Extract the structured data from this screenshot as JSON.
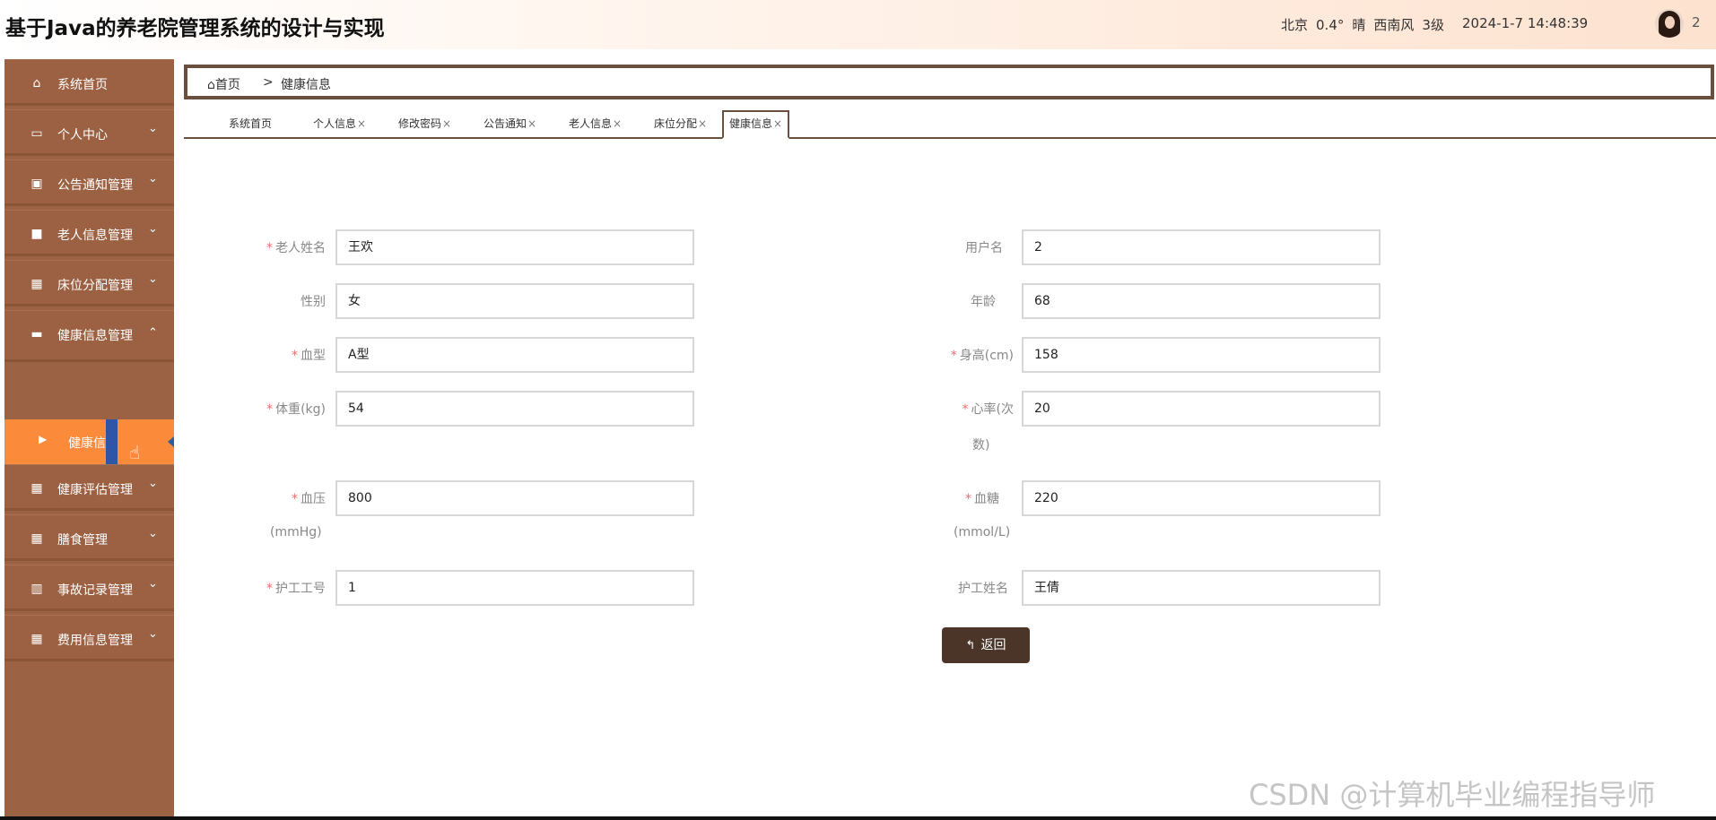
{
  "header": {
    "title": "基于Java的养老院管理系统的设计与实现",
    "weather": {
      "city": "北京",
      "temp": "0.4°",
      "condition": "晴",
      "wind": "西南风",
      "level": "3级"
    },
    "datetime": "2024-1-7 14:48:39",
    "user": "2"
  },
  "sidebar": {
    "items": [
      {
        "label": "系统首页",
        "icon": "home-icon"
      },
      {
        "label": "个人中心",
        "icon": "card-icon"
      },
      {
        "label": "公告通知管理",
        "icon": "clipboard-icon"
      },
      {
        "label": "老人信息管理",
        "icon": "briefcase-icon"
      },
      {
        "label": "床位分配管理",
        "icon": "grid-icon"
      },
      {
        "label": "健康信息管理",
        "icon": "ticket-icon"
      },
      {
        "label": "健康评估管理",
        "icon": "grid-icon"
      },
      {
        "label": "膳食管理",
        "icon": "grid-icon"
      },
      {
        "label": "事故记录管理",
        "icon": "chart-icon"
      },
      {
        "label": "费用信息管理",
        "icon": "grid-icon"
      }
    ],
    "submenu": {
      "label": "健康信息"
    }
  },
  "breadcrumb": {
    "home": "首页",
    "separator": ">",
    "current": "健康信息"
  },
  "tabs": [
    {
      "label": "系统首页"
    },
    {
      "label": "个人信息"
    },
    {
      "label": "修改密码"
    },
    {
      "label": "公告通知"
    },
    {
      "label": "老人信息"
    },
    {
      "label": "床位分配"
    },
    {
      "label": "健康信息"
    }
  ],
  "form": {
    "elder_name": {
      "label": "老人姓名",
      "value": "王欢"
    },
    "username": {
      "label": "用户名",
      "value": "2"
    },
    "gender": {
      "label": "性别",
      "value": "女"
    },
    "age": {
      "label": "年龄",
      "value": "68"
    },
    "blood_type": {
      "label": "血型",
      "value": "A型"
    },
    "height": {
      "label": "身高(cm)",
      "value": "158"
    },
    "weight": {
      "label": "体重(kg)",
      "value": "54"
    },
    "heart_rate": {
      "label1": "心率(次",
      "label2": "数)",
      "value": "20"
    },
    "blood_pressure": {
      "label1": "血压",
      "label2": "(mmHg)",
      "value": "800"
    },
    "blood_sugar": {
      "label1": "血糖",
      "label2": "(mmol/L)",
      "value": "220"
    },
    "nurse_id": {
      "label": "护工工号",
      "value": "1"
    },
    "nurse_name": {
      "label": "护工姓名",
      "value": "王倩"
    },
    "back_button": "返回"
  },
  "watermark": "CSDN @计算机毕业编程指导师"
}
